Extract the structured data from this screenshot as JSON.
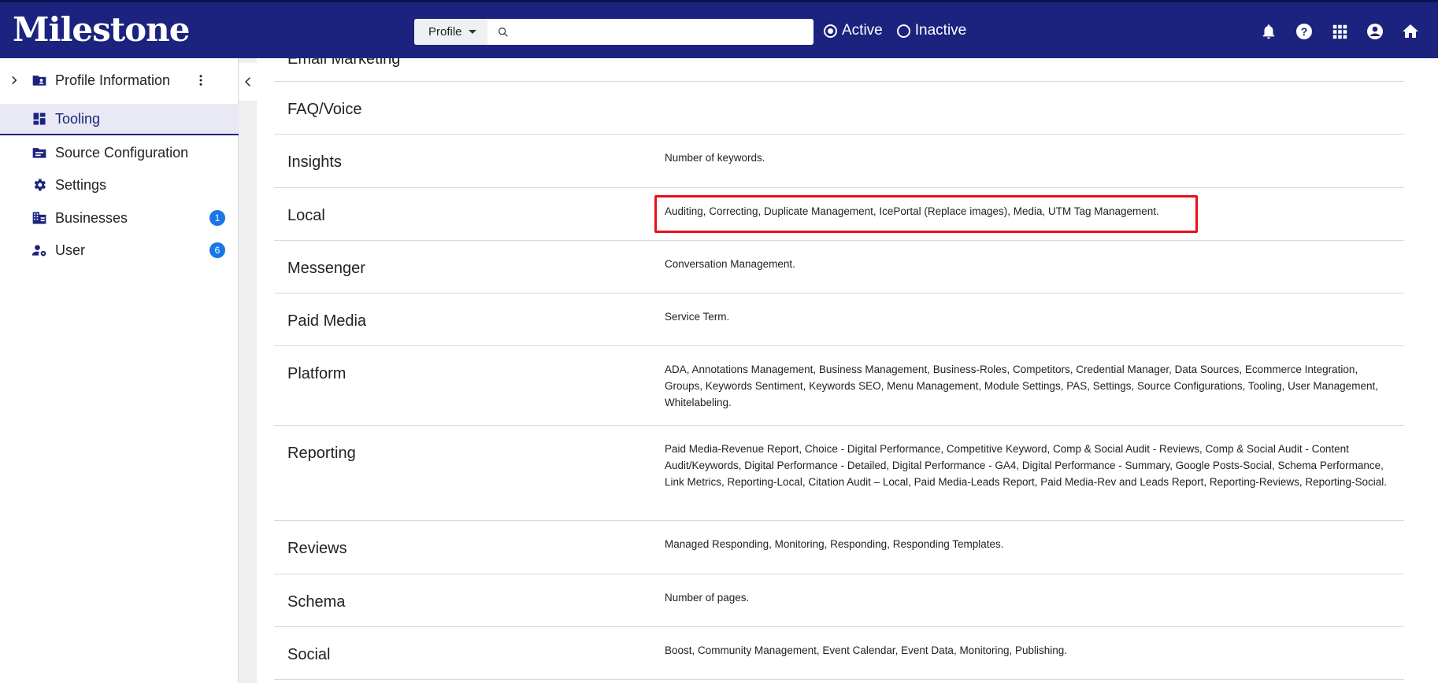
{
  "header": {
    "logo": "Milestone",
    "search": {
      "select_label": "Profile",
      "placeholder": ""
    },
    "radios": [
      {
        "label": "Active",
        "checked": true
      },
      {
        "label": "Inactive",
        "checked": false
      }
    ],
    "icons": [
      "bell-icon",
      "help-icon",
      "apps-grid-icon",
      "account-icon",
      "home-icon"
    ]
  },
  "sidebar": {
    "items": [
      {
        "label": "Profile Information",
        "icon": "folder-user-icon"
      },
      {
        "label": "Tooling",
        "icon": "dashboard-icon",
        "active": true
      },
      {
        "label": "Source Configuration",
        "icon": "source-icon"
      },
      {
        "label": "Settings",
        "icon": "gear-icon"
      },
      {
        "label": "Businesses",
        "icon": "building-icon",
        "badge": "1"
      },
      {
        "label": "User",
        "icon": "user-settings-icon",
        "badge": "6"
      }
    ]
  },
  "tooling": {
    "rows": [
      {
        "category": "Email Marketing",
        "description": ""
      },
      {
        "category": "FAQ/Voice",
        "description": ""
      },
      {
        "category": "Insights",
        "description": "Number of keywords."
      },
      {
        "category": "Local",
        "description": "Auditing, Correcting, Duplicate Management, IcePortal (Replace images), Media, UTM Tag Management."
      },
      {
        "category": "Messenger",
        "description": "Conversation Management."
      },
      {
        "category": "Paid Media",
        "description": "Service Term."
      },
      {
        "category": "Platform",
        "description": "ADA, Annotations Management, Business Management, Business-Roles, Competitors, Credential Manager, Data Sources, Ecommerce Integration, Groups, Keywords Sentiment, Keywords SEO, Menu Management, Module Settings, PAS, Settings, Source Configurations, Tooling, User Management, Whitelabeling."
      },
      {
        "category": "Reporting",
        "description": "Paid Media-Revenue Report, Choice - Digital Performance, Competitive Keyword, Comp & Social Audit - Reviews, Comp & Social Audit - Content Audit/Keywords, Digital Performance - Detailed, Digital Performance - GA4, Digital Performance - Summary, Google Posts-Social, Schema Performance, Link Metrics, Reporting-Local, Citation Audit – Local, Paid Media-Leads Report, Paid Media-Rev and Leads Report, Reporting-Reviews, Reporting-Social."
      },
      {
        "category": "Reviews",
        "description": "Managed Responding, Monitoring, Responding, Responding Templates."
      },
      {
        "category": "Schema",
        "description": "Number of pages."
      },
      {
        "category": "Social",
        "description": "Boost, Community Management, Event Calendar, Event Data, Monitoring, Publishing."
      }
    ]
  },
  "colors": {
    "header_bg": "#1b237e",
    "badge": "#1976e8",
    "highlight": "#e8101a"
  }
}
